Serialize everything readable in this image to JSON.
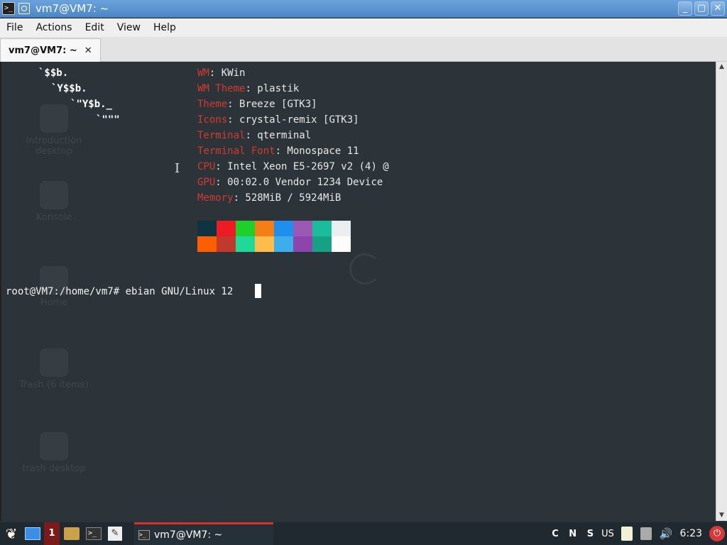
{
  "window": {
    "title": "vm7@VM7: ~",
    "app_icon": ">_",
    "buttons": {
      "minimize": "_",
      "maximize": "▢",
      "close": "✕"
    }
  },
  "menu": {
    "items": [
      "File",
      "Actions",
      "Edit",
      "View",
      "Help"
    ]
  },
  "tab": {
    "label": "vm7@VM7: ~",
    "close": "✕"
  },
  "terminal": {
    "logo": [
      "`$$b.",
      "`Y$$b.",
      "`\"Y$b._",
      "`\"\"\""
    ],
    "info": [
      {
        "key": "WM",
        "value": ": KWin"
      },
      {
        "key": "WM Theme",
        "value": ": plastik"
      },
      {
        "key": "Theme",
        "value": ": Breeze [GTK3]"
      },
      {
        "key": "Icons",
        "value": ": crystal-remix [GTK3]"
      },
      {
        "key": "Terminal",
        "value": ": qterminal"
      },
      {
        "key": "Terminal Font",
        "value": ": Monospace 11"
      },
      {
        "key": "CPU",
        "value": ": Intel Xeon E5-2697 v2 (4) @"
      },
      {
        "key": "GPU",
        "value": ": 00:02.0 Vendor 1234 Device"
      },
      {
        "key": "Memory",
        "value": ": 528MiB / 5924MiB"
      }
    ],
    "palette_top": [
      "#0d3440",
      "#ed1c24",
      "#1fcf2a",
      "#f57f17",
      "#1f8fee",
      "#9b59b6",
      "#1abc9c",
      "#eceff1"
    ],
    "palette_bottom": [
      "#fc5f03",
      "#c0392b",
      "#1fd89a",
      "#fdbc4b",
      "#3daee9",
      "#8e44ad",
      "#16a085",
      "#fcfcfc"
    ],
    "prompt": "root@VM7:/home/vm7# ebian GNU/Linux 12 ",
    "desktop_icons": [
      "Introduction desktop",
      "Konsole",
      "Home",
      "Trash (6 items)",
      "trash desktop"
    ]
  },
  "scrollbar": {
    "up": "▲",
    "down": "▼"
  },
  "taskbar": {
    "start_icon": "❦",
    "workspace": "1",
    "task_label": "vm7@VM7: ~",
    "task_icon": ">_",
    "edit_icon": "✎",
    "keyboard_indicators": "C N S",
    "layout": "US",
    "volume_icon": "🔊",
    "clock": "6:23",
    "power_icon": "⏻"
  }
}
